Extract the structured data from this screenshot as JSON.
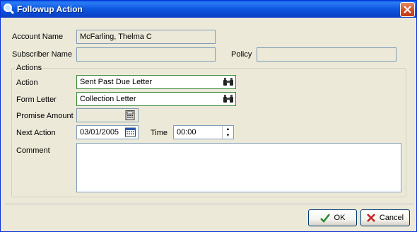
{
  "window": {
    "title": "Followup Action"
  },
  "account": {
    "account_name_label": "Account Name",
    "account_name_value": "McFarling, Thelma C",
    "subscriber_name_label": "Subscriber Name",
    "subscriber_name_value": "",
    "policy_label": "Policy",
    "policy_value": ""
  },
  "actions": {
    "group_title": "Actions",
    "action_label": "Action",
    "action_value": "Sent Past Due Letter",
    "form_letter_label": "Form Letter",
    "form_letter_value": "Collection Letter",
    "promise_amount_label": "Promise Amount",
    "promise_amount_value": "",
    "next_action_label": "Next Action",
    "next_action_value": "03/01/2005",
    "time_label": "Time",
    "time_value": "00:00",
    "comment_label": "Comment",
    "comment_value": ""
  },
  "buttons": {
    "ok_label": "OK",
    "cancel_label": "Cancel"
  },
  "icons": {
    "title": "magnifier-icon",
    "close": "close-icon",
    "lookup": "binoculars-icon",
    "calculator": "calculator-icon",
    "calendar": "calendar-icon",
    "ok": "checkmark-icon",
    "cancel": "x-icon"
  }
}
